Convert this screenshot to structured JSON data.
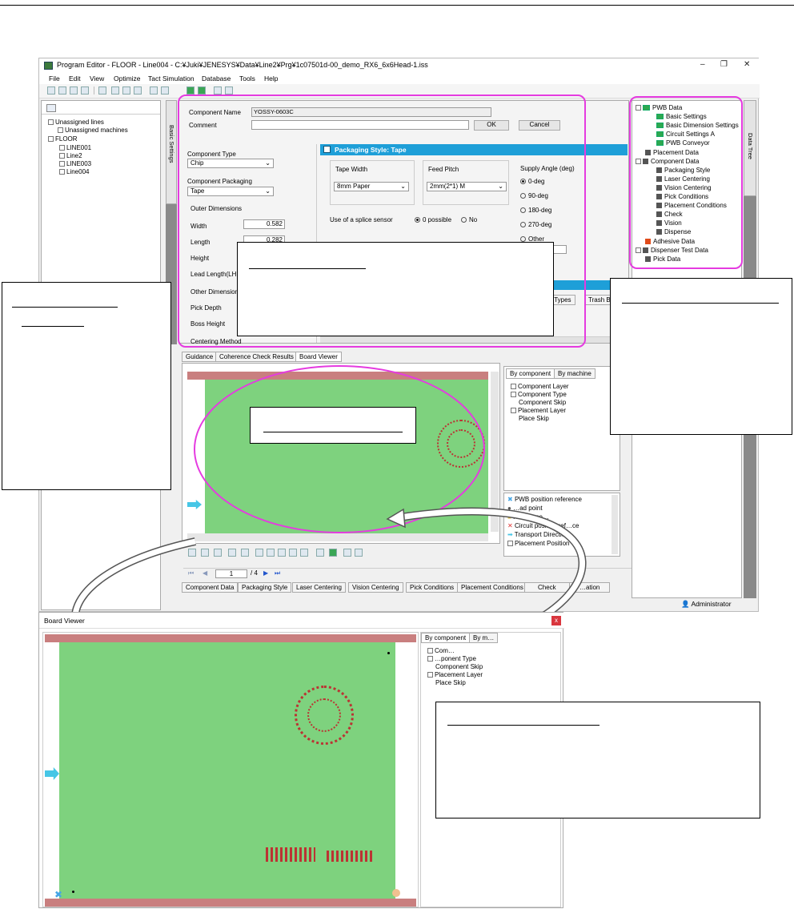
{
  "window": {
    "title": "Program Editor - FLOOR - Line004 - C:¥Juki¥JENESYS¥Data¥Line2¥Prg¥1c07501d-00_demo_RX6_6x6Head-1.iss",
    "controls": [
      "–",
      "❐",
      "✕"
    ]
  },
  "menu": [
    "File",
    "Edit",
    "View",
    "Optimize",
    "Tact Simulation",
    "Database",
    "Tools",
    "Help"
  ],
  "left_tree": {
    "items": [
      "Unassigned lines",
      "Unassigned machines",
      "FLOOR",
      "LINE001",
      "Line2",
      "LINE003",
      "Line004"
    ]
  },
  "side_tabs": {
    "basic_settings": "Basic Settings",
    "data_tree": "Data Tree"
  },
  "component_form": {
    "name_label": "Component Name",
    "name_value": "YOSSY-0603C",
    "comment_label": "Comment",
    "ok": "OK",
    "cancel": "Cancel",
    "type_label": "Component Type",
    "type_value": "Chip",
    "packaging_label": "Component Packaging",
    "packaging_value": "Tape",
    "outer_label": "Outer Dimensions",
    "width_label": "Width",
    "width_value": "0.582",
    "length_label": "Length",
    "length_value": "0.282",
    "height_label": "Height",
    "lead_label": "Lead Length(LH",
    "other_label": "Other Dimension",
    "pick_depth": "Pick Depth",
    "boss_height": "Boss Height",
    "centering": "Centering Method"
  },
  "packaging": {
    "header": "Packaging Style: Tape",
    "tape_width_label": "Tape Width",
    "tape_width_value": "8mm Paper",
    "feed_pitch_label": "Feed Pitch",
    "feed_pitch_value": "2mm(2*1) M",
    "supply_angle_label": "Supply Angle (deg)",
    "angles": [
      "0-deg",
      "90-deg",
      "180-deg",
      "270-deg",
      "Other"
    ],
    "splice_label": "Use of a splice sensor",
    "splice_yes": "0 possible",
    "splice_no": "No",
    "lower_tabs": [
      "hine Types",
      "Trash B"
    ]
  },
  "data_tree": {
    "pwb_data": "PWB Data",
    "pwb_children": [
      "Basic Settings",
      "Basic Dimension Settings",
      "Circuit Settings A",
      "PWB Conveyor"
    ],
    "placement_data": "Placement Data",
    "component_data": "Component Data",
    "component_children": [
      "Packaging Style",
      "Laser Centering",
      "Vision Centering",
      "Pick Conditions",
      "Placement Conditions",
      "Check",
      "Vision",
      "Dispense"
    ],
    "adhesive": "Adhesive Data",
    "dispenser": "Dispenser Test Data",
    "pick": "Pick Data"
  },
  "viewer_tabs": [
    "Guidance",
    "Coherence Check Results",
    "Board Viewer"
  ],
  "by_tabs": [
    "By component",
    "By machine"
  ],
  "by_tree": [
    "Component Layer",
    "Component Type",
    "Component Skip",
    "Placement Layer",
    "Place Skip"
  ],
  "legend": [
    "PWB position reference",
    "…ad point",
    "Reference…",
    "Circuit position ref…ce",
    "Transport Direction",
    "Placement Position"
  ],
  "pager": {
    "page": "1",
    "total": "/ 4"
  },
  "bottom_tabs": [
    "Component Data",
    "Packaging Style",
    "Laser Centering",
    "Vision Centering",
    "Pick Conditions",
    "Placement Conditions",
    "Check",
    "…ation"
  ],
  "status": {
    "user": "Administrator"
  },
  "board_viewer_window": {
    "title": "Board Viewer",
    "close": "x",
    "tabs": [
      "By component",
      "By m…"
    ],
    "tree": [
      "Com…",
      "…ponent Type",
      "Component Skip",
      "Placement Layer",
      "Place Skip"
    ]
  },
  "colors": {
    "highlight": "#e53be0",
    "pcb": "#7ed27e",
    "pcb_edge": "#c97f7f",
    "header_blue": "#1e9fd8"
  }
}
